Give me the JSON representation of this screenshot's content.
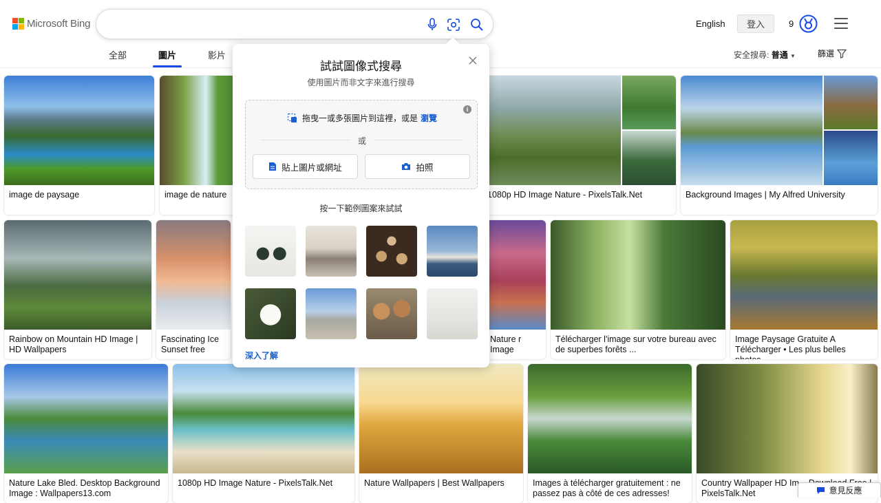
{
  "brand": {
    "logo_text": "Microsoft Bing",
    "logo_colors": [
      "#f25022",
      "#7fba00",
      "#00a4ef",
      "#ffb900"
    ]
  },
  "search": {
    "query": "",
    "placeholder": "",
    "icons": [
      "microphone-icon",
      "visual-search-icon",
      "search-icon"
    ]
  },
  "header": {
    "language": "English",
    "signin_label": "登入",
    "rewards_count": "9",
    "accent": "#174ae4"
  },
  "tabs": [
    {
      "label": "全部",
      "active": false
    },
    {
      "label": "圖片",
      "active": true
    },
    {
      "label": "影片",
      "active": false
    }
  ],
  "safe_search": {
    "label": "安全搜尋:",
    "value": "普通"
  },
  "filter_label": "篩選",
  "results": [
    {
      "caption": "image de paysage"
    },
    {
      "caption": "image de nature"
    },
    {
      "caption": "1080p HD Image Nature - PixelsTalk.Net"
    },
    {
      "caption": "Background Images | My Alfred University"
    },
    {
      "caption": "Rainbow on Mountain HD Image | HD Wallpapers"
    },
    {
      "caption": "Fascinating Ice Sunset free"
    },
    {
      "caption": "Nature r Image"
    },
    {
      "caption": "Télécharger l'image sur votre bureau avec de superbes forêts ..."
    },
    {
      "caption": "Image Paysage Gratuite A Télécharger • Les plus belles photos"
    },
    {
      "caption": "Nature Lake Bled. Desktop Background Image : Wallpapers13.com"
    },
    {
      "caption": "1080p HD Image Nature - PixelsTalk.Net"
    },
    {
      "caption": "Nature Wallpapers | Best Wallpapers"
    },
    {
      "caption": "Images à télécharger gratuitement : ne passez pas à côté de ces adresses!"
    },
    {
      "caption": "Country Wallpaper HD Im... Download Free | PixelsTalk.Net"
    }
  ],
  "visual_search_popup": {
    "title": "試試圖像式搜尋",
    "subtitle": "使用圖片而非文字來進行搜尋",
    "drop_text": "拖曳一或多張圖片到這裡，或是",
    "browse_label": "瀏覽",
    "or_label": "或",
    "paste_button": "貼上圖片或網址",
    "camera_button": "拍照",
    "try_text": "按一下範例圖案來試試",
    "learn_more": "深入了解",
    "samples": [
      "sunglasses",
      "dining-room",
      "coffee-cups",
      "sydney-opera-house",
      "white-rose",
      "louvre-pyramid",
      "dogs",
      "white-chair"
    ]
  },
  "feedback_label": "意見反應"
}
